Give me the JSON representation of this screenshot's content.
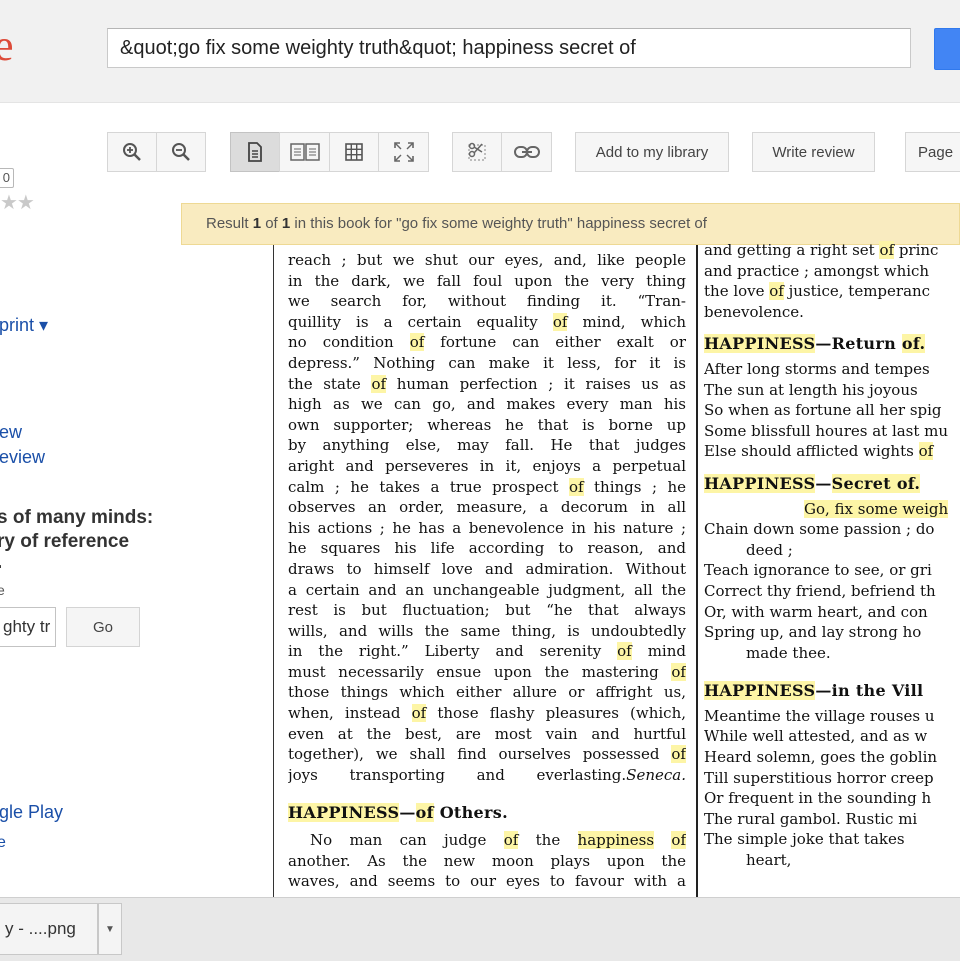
{
  "header": {
    "logo_fragment": "e",
    "search_value": "&quot;go fix some weighty truth&quot; happiness secret of"
  },
  "toolbar": {
    "add_library_label": "Add to my library",
    "write_review_label": "Write review",
    "page_label": "Page"
  },
  "left_panel": {
    "print_link": "print ▾",
    "rating_count": "0",
    "stars": "★★",
    "review_link_1": "ew",
    "review_link_2": "eview",
    "book_title_1": "s of many minds:",
    "book_title_2": "ry of reference",
    "book_title_3": ".",
    "small_text_1": "e",
    "book_search_value": "ghty tru",
    "go_label": "Go",
    "google_play_link": "gle Play",
    "small_text_2": "e"
  },
  "result_banner": {
    "prefix": "Result ",
    "current": "1",
    "of_word": " of ",
    "total": "1",
    "suffix": " in this book for \"go fix some weighty truth\" happiness secret of"
  },
  "book_page": {
    "left_lines_1": [
      "reach ; but we shut our eyes, and, like people",
      "in the dark, we fall foul upon the very thing",
      "we search for, without finding it.  “Tran-"
    ],
    "left_lines_2": [
      "quillity is a certain equality ",
      "of",
      " mind, which"
    ],
    "left_line_5": [
      "no condition ",
      "of",
      " fortune can either exalt or"
    ],
    "left_line_6": "depress.”  Nothing can make it less, for it is",
    "left_line_7": [
      "the state ",
      "of",
      " human perfection ; it raises us as"
    ],
    "left_lines_3": [
      "high as we can go, and makes every man his",
      "own supporter; whereas he that is borne up",
      "by anything else, may fall.  He that judges",
      "aright and perseveres in it, enjoys a perpetual"
    ],
    "left_line_12": [
      "calm ; he takes a true prospect ",
      "of",
      " things ; he"
    ],
    "left_lines_4": [
      "observes an order, measure, a decorum in all",
      "his actions ; he has a benevolence in his nature ;",
      "he squares his life according to reason, and",
      "draws to himself love and admiration.  Without",
      "a certain and an unchangeable judgment, all the",
      "rest is but fluctuation; but “he that always",
      "wills, and wills the same thing, is undoubtedly"
    ],
    "left_line_20": [
      "in the right.”  Liberty and serenity ",
      "of",
      " mind"
    ],
    "left_line_21": [
      "must necessarily ensue upon the mastering ",
      "of"
    ],
    "left_line_22": "those things which either allure or affright us,",
    "left_line_23": [
      "when, instead ",
      "of",
      " those flashy pleasures (which,"
    ],
    "left_line_24": "even at the best, are most vain and hurtful",
    "left_line_25": [
      "together), we shall find ourselves possessed ",
      "of"
    ],
    "left_line_26": [
      "joys transporting and everlasting.",
      "Seneca."
    ],
    "left_heading": [
      "HAPPINESS",
      "—",
      "of",
      " Others."
    ],
    "left_line_28": [
      "No man can judge ",
      "of",
      " the ",
      "happiness",
      " ",
      "of"
    ],
    "left_line_29": "another.  As the new moon plays upon the",
    "left_line_30": "waves, and seems to our eyes to favour with a",
    "right_line_1": [
      "and getting a right set ",
      "of",
      " princ"
    ],
    "right_line_2": "and practice ; amongst which",
    "right_line_3": [
      "the love ",
      "of",
      " justice, temperanc"
    ],
    "right_line_4": "benevolence.",
    "right_heading_1": [
      "HAPPINESS",
      "—Return ",
      "of."
    ],
    "right_poem_1": [
      "After long storms and tempes",
      "The sun at length his joyous",
      "So when as fortune all her spig",
      "Some blissfull houres at last mu"
    ],
    "right_poem_1_last": [
      "Else should afflicted wights ",
      "of"
    ],
    "right_heading_2": [
      "HAPPINESS",
      "—",
      "Secret of."
    ],
    "right_quote": "Go, fix some weigh",
    "right_poem_2": [
      "Chain down some passion ; do",
      "deed ;",
      "Teach ignorance to see, or gri",
      "Correct thy friend, befriend th",
      "Or, with warm heart, and con",
      "Spring up, and lay strong ho",
      "made thee."
    ],
    "right_heading_3": [
      "HAPPINESS",
      "—in the Vill"
    ],
    "right_poem_3": [
      "Meantime the village rouses u",
      "While well attested, and as w",
      "Heard solemn, goes the goblin",
      "Till superstitious horror creep",
      "Or frequent in the sounding h",
      "The rural gambol.  Rustic mi",
      "The simple joke that takes",
      "heart,"
    ]
  },
  "bottom_bar": {
    "download_label": "y - ....png"
  }
}
